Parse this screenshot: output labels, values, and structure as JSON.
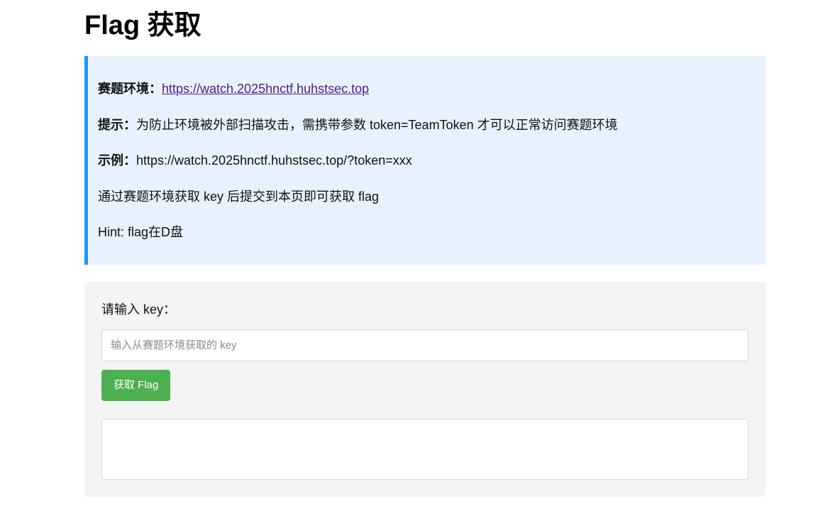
{
  "header": {
    "title": "Flag 获取"
  },
  "info": {
    "env_label": "赛题环境：",
    "env_link": "https://watch.2025hnctf.huhstsec.top",
    "tip_label": "提示：",
    "tip_text": "为防止环境被外部扫描攻击，需携带参数 token=TeamToken 才可以正常访问赛题环境",
    "example_label": "示例：",
    "example_text": "https://watch.2025hnctf.huhstsec.top/?token=xxx",
    "instruction": "通过赛题环境获取 key 后提交到本页即可获取 flag",
    "hint": "Hint: flag在D盘"
  },
  "form": {
    "label": "请输入 key：",
    "input_placeholder": "输入从赛题环境获取的 key",
    "input_value": "",
    "button_label": "获取 Flag",
    "result_text": ""
  },
  "colors": {
    "accent_border": "#2196f3",
    "info_background": "#e6f3ff",
    "button_background": "#4caf50",
    "form_background": "#f4f4f4"
  }
}
